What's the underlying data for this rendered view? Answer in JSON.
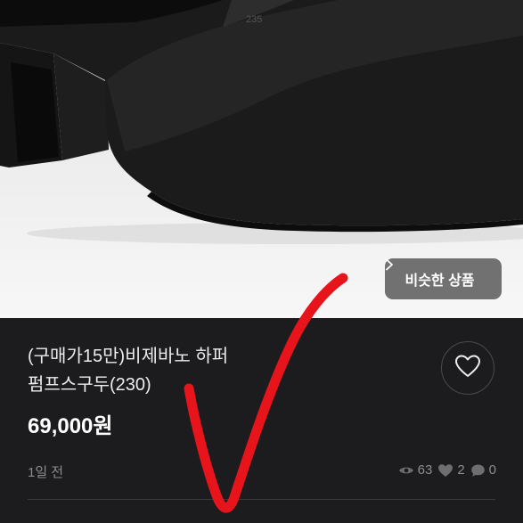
{
  "product": {
    "title_line1": "(구매가15만)비제바노 하퍼",
    "title_line2": "펌프스구두(230)",
    "price": "69,000원",
    "posted": "1일 전"
  },
  "image": {
    "size_mark": "235"
  },
  "similar_button": {
    "label": "비슷한 상품",
    "icon": "chevron-right-icon"
  },
  "like_button": {
    "icon": "heart-outline-icon"
  },
  "stats": {
    "views": "63",
    "likes": "2",
    "chats": "0"
  },
  "colors": {
    "panel_bg": "#1c1c1e",
    "muted_text": "#8d8d8f",
    "check_mark": "#e8141c"
  }
}
